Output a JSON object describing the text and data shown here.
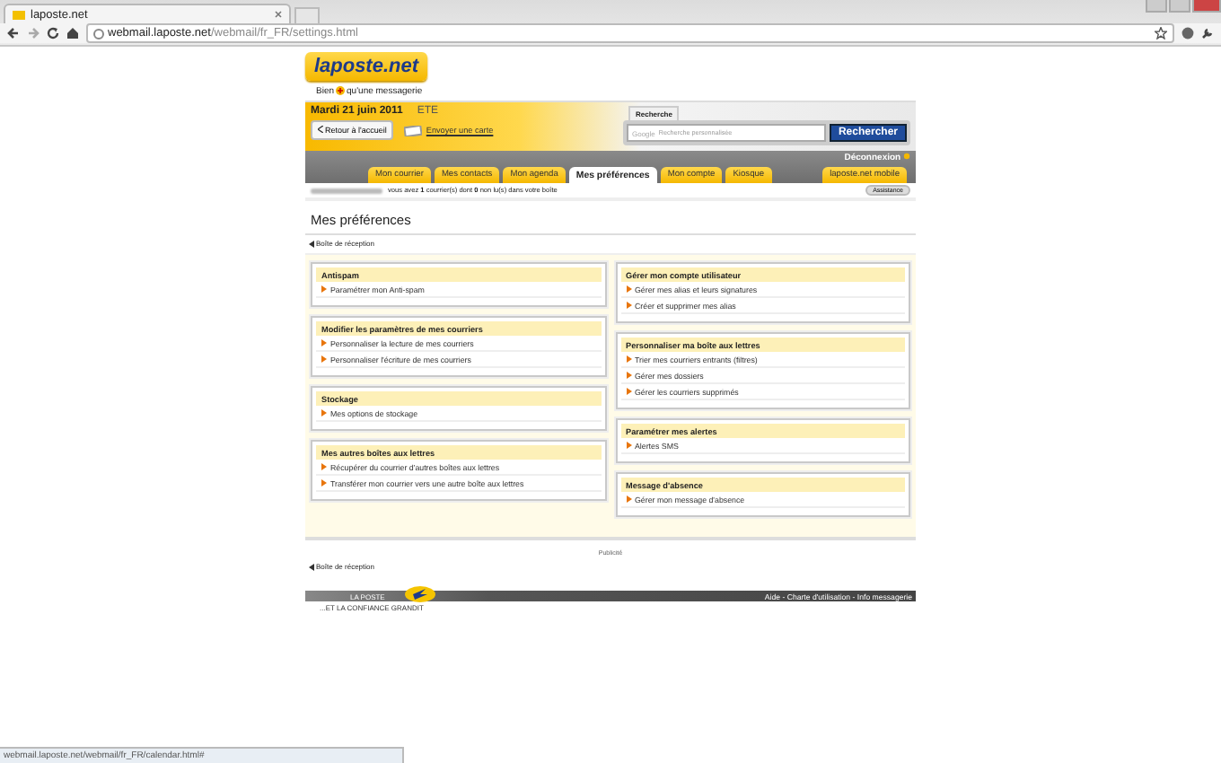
{
  "browser": {
    "tab_title": "laposte.net",
    "url_host": "webmail.laposte.net",
    "url_path": "/webmail/fr_FR/settings.html"
  },
  "header": {
    "logo": "laposte.net",
    "tagline_before": "Bien",
    "tagline_after": "qu'une messagerie",
    "date": "Mardi 21 juin 2011",
    "season": "ETE",
    "back_button": "Retour à l'accueil",
    "card_link": "Envoyer une carte",
    "search_tab": "Recherche",
    "search_provider": "Google",
    "search_placeholder": "Recherche personnalisée",
    "search_button": "Rechercher",
    "logout": "Déconnexion"
  },
  "tabs": [
    {
      "label": "Mon courrier",
      "selected": false
    },
    {
      "label": "Mes contacts",
      "selected": false
    },
    {
      "label": "Mon agenda",
      "selected": false
    },
    {
      "label": "Mes préférences",
      "selected": true
    },
    {
      "label": "Mon compte",
      "selected": false
    },
    {
      "label": "Kiosque",
      "selected": false
    },
    {
      "label": "laposte.net mobile",
      "selected": false
    }
  ],
  "info": {
    "message": "vous avez **1** courrier(s) dont **0** non lu(s) dans votre boîte",
    "assistance": "Assistance"
  },
  "page": {
    "title": "Mes préférences",
    "back_link": "Boîte de réception"
  },
  "columns": [
    [
      {
        "title": "Antispam",
        "links": [
          "Paramétrer mon Anti-spam"
        ]
      },
      {
        "title": "Modifier les paramètres de mes courriers",
        "links": [
          "Personnaliser la lecture de mes courriers",
          "Personnaliser l'écriture de mes courriers"
        ]
      },
      {
        "title": "Stockage",
        "links": [
          "Mes options de stockage"
        ]
      },
      {
        "title": "Mes autres boîtes aux lettres",
        "links": [
          "Récupérer du courrier d'autres boîtes aux lettres",
          "Transférer mon courrier vers une autre boîte aux lettres"
        ]
      }
    ],
    [
      {
        "title": "Gérer mon compte utilisateur",
        "links": [
          "Gérer mes alias et leurs signatures",
          "Créer et supprimer mes alias"
        ]
      },
      {
        "title": "Personnaliser ma boîte aux lettres",
        "links": [
          "Trier mes courriers entrants (filtres)",
          "Gérer mes dossiers",
          "Gérer les courriers supprimés"
        ]
      },
      {
        "title": "Paramétrer mes alertes",
        "links": [
          "Alertes SMS"
        ]
      },
      {
        "title": "Message d'absence",
        "links": [
          "Gérer mon message d'absence"
        ]
      }
    ]
  ],
  "ad_label": "Publicité",
  "bottom_back_link": "Boîte de réception",
  "footer": {
    "logo": "LA POSTE",
    "slogan": "...ET LA CONFIANCE GRANDIT",
    "links": [
      "Aide",
      "Charte d'utilisation",
      "Info messagerie"
    ],
    "separator": "-"
  },
  "status_url": "webmail.laposte.net/webmail/fr_FR/calendar.html#"
}
